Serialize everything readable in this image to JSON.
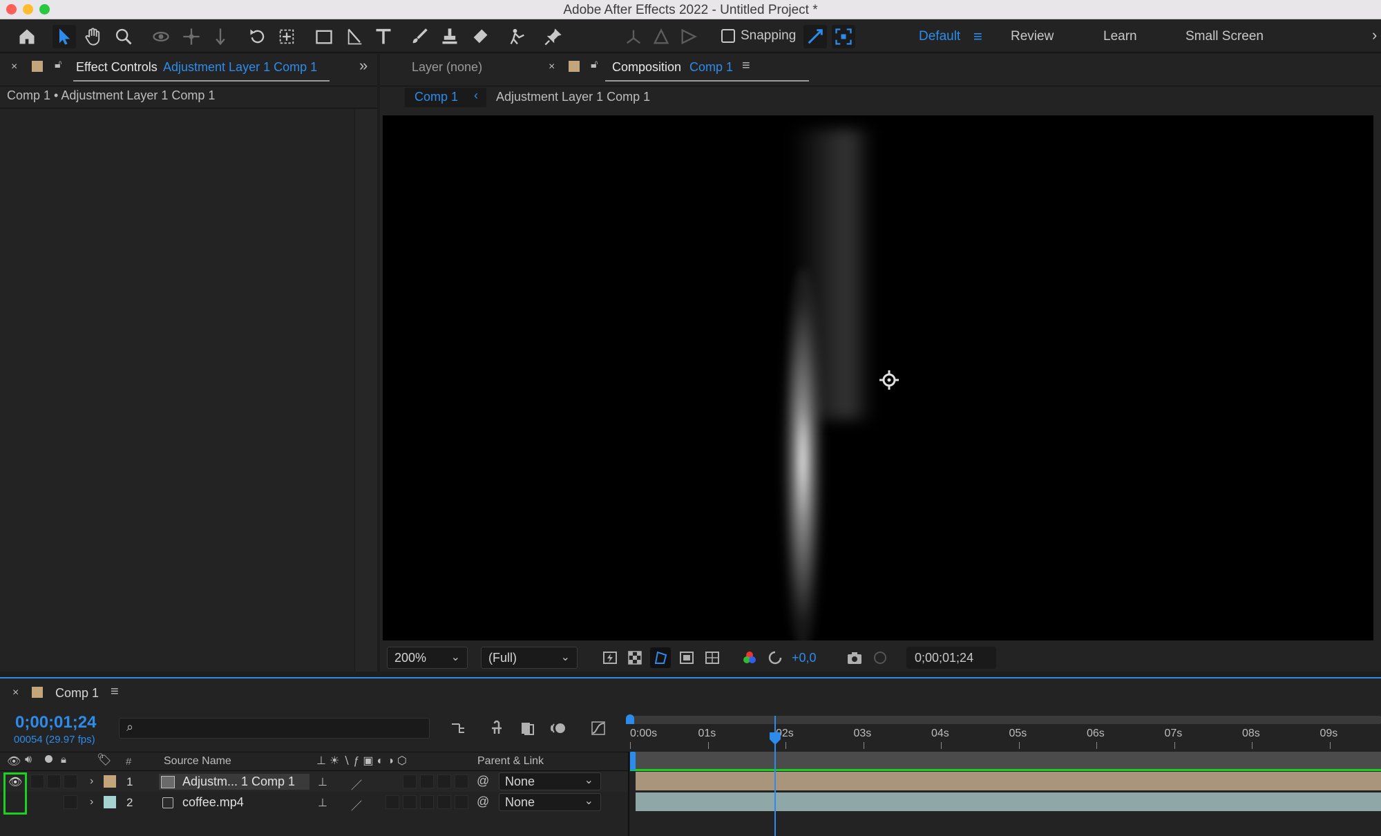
{
  "app": {
    "window_title": "Adobe After Effects 2022 - Untitled Project *"
  },
  "toolbar": {
    "snapping_label": "Snapping",
    "workspaces": [
      "Default",
      "Review",
      "Learn",
      "Small Screen"
    ]
  },
  "effect_controls": {
    "tab_prefix": "Effect Controls",
    "tab_target": "Adjustment Layer 1 Comp 1",
    "breadcrumb": "Comp 1 • Adjustment Layer 1 Comp 1"
  },
  "viewer": {
    "layer_tab": "Layer (none)",
    "comp_tab_prefix": "Composition",
    "comp_tab_target": "Comp 1",
    "crumb_comp": "Comp 1",
    "crumb_layer": "Adjustment Layer 1 Comp 1",
    "zoom": "200%",
    "resolution": "(Full)",
    "exposure": "+0,0",
    "timecode": "0;00;01;24"
  },
  "timeline": {
    "tab": "Comp 1",
    "current_time": "0;00;01;24",
    "frame_info": "00054 (29.97 fps)",
    "columns": {
      "hash": "#",
      "source_name": "Source Name",
      "parent_link": "Parent & Link"
    },
    "ruler_labels": [
      "0:00s",
      "01s",
      "02s",
      "03s",
      "04s",
      "05s",
      "06s",
      "07s",
      "08s",
      "09s"
    ],
    "layers": [
      {
        "num": "1",
        "name": "Adjustm... 1 Comp 1",
        "parent": "None",
        "label_color": "#c2a57a",
        "bar_color": "#a9957c"
      },
      {
        "num": "2",
        "name": "coffee.mp4",
        "parent": "None",
        "label_color": "#a6d2cf",
        "bar_color": "#8fa8a7"
      }
    ]
  },
  "colors": {
    "accent": "#2d8ceb",
    "highlight_green": "#19d11e"
  }
}
